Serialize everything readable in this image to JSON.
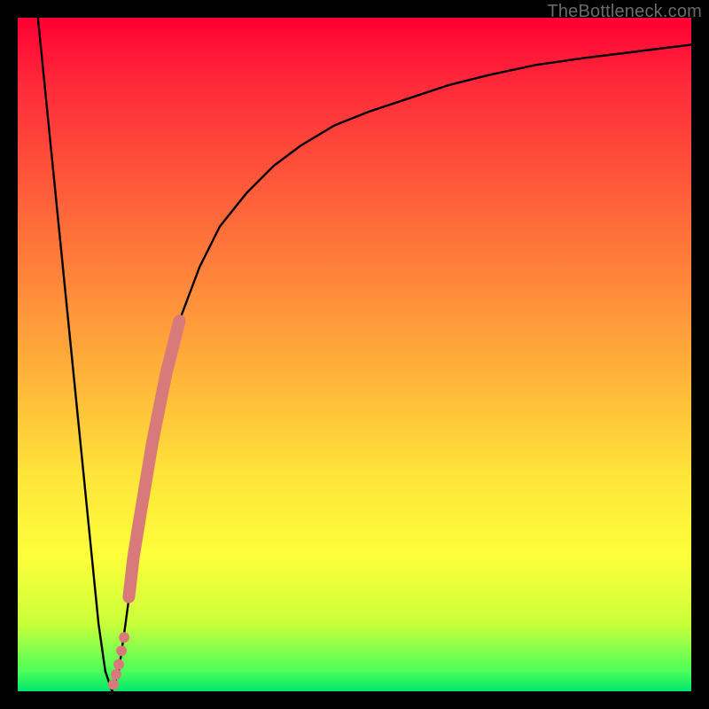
{
  "watermark": "TheBottleneck.com",
  "chart_data": {
    "type": "line",
    "title": "",
    "xlabel": "",
    "ylabel": "",
    "xlim": [
      0,
      100
    ],
    "ylim": [
      0,
      100
    ],
    "series": [
      {
        "name": "curve",
        "x": [
          3,
          5,
          7,
          9,
          11,
          12,
          13,
          14,
          15,
          16,
          18,
          20,
          22,
          24,
          27,
          30,
          34,
          38,
          42,
          47,
          52,
          58,
          64,
          70,
          77,
          84,
          92,
          100
        ],
        "y": [
          100,
          80,
          60,
          40,
          20,
          10,
          3,
          0,
          3,
          10,
          25,
          37,
          47,
          55,
          63,
          69,
          74,
          78,
          81,
          84,
          86,
          88,
          90,
          91.5,
          93,
          94,
          95,
          96
        ]
      }
    ],
    "highlight_segment": {
      "name": "highlight",
      "x": [
        16.5,
        17.2,
        18,
        19,
        20,
        21,
        22,
        23,
        24
      ],
      "y": [
        14,
        20,
        25,
        31,
        37,
        42,
        47,
        51,
        55
      ]
    },
    "highlight_dots": {
      "name": "dots",
      "x": [
        14.2,
        14.6,
        15.0,
        15.4,
        15.8
      ],
      "y": [
        1,
        2.5,
        4,
        6,
        8
      ]
    }
  }
}
